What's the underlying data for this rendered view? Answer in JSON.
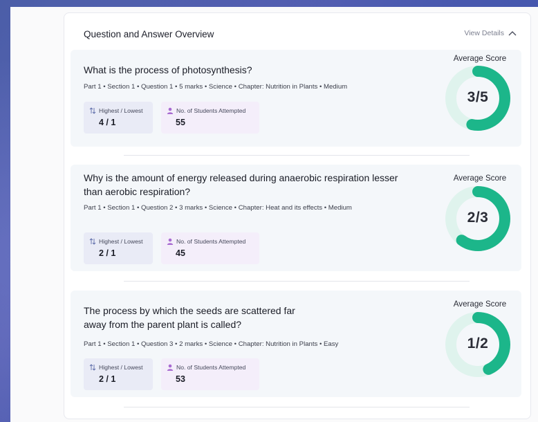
{
  "overview": {
    "title": "Question and Answer Overview",
    "view_details": "View Details",
    "chevron_icon": "chevron-up-icon"
  },
  "colors": {
    "accent": "#1cb68a",
    "ring_track": "#dff3ed"
  },
  "questions": [
    {
      "title_lines": [
        "What is the process of photosynthesis?"
      ],
      "meta": "Part 1 • Section 1 • Question 1 • 5 marks • Science  • Chapter: Nutrition in Plants • Medium",
      "highest_lowest_label": "Highest / Lowest",
      "highest_lowest_value": "4 / 1",
      "students_label": "No. of Students Attempted",
      "students_value": "55",
      "avg_label": "Average Score",
      "score_text": "3/5",
      "score_fraction": 0.6
    },
    {
      "title_lines": [
        "Why is the amount of energy released during anaerobic respiration lesser",
        "than aerobic respiration?"
      ],
      "meta": "Part 1 • Section 1 • Question 2 • 3 marks • Science  • Chapter: Heat and its effects • Medium",
      "highest_lowest_label": "Highest / Lowest",
      "highest_lowest_value": "2 / 1",
      "students_label": "No. of Students Attempted",
      "students_value": "45",
      "avg_label": "Average Score",
      "score_text": "2/3",
      "score_fraction": 0.6667
    },
    {
      "title_lines": [
        "The process by which the seeds are scattered far",
        "away from the parent plant is called?"
      ],
      "meta": "Part 1 • Section 1 • Question 3 • 2 marks • Science • Chapter: Nutrition in Plants • Easy",
      "highest_lowest_label": "Highest / Lowest",
      "highest_lowest_value": "2 / 1",
      "students_label": "No. of Students Attempted",
      "students_value": "53",
      "avg_label": "Average Score",
      "score_text": "1/2",
      "score_fraction": 0.5
    }
  ]
}
